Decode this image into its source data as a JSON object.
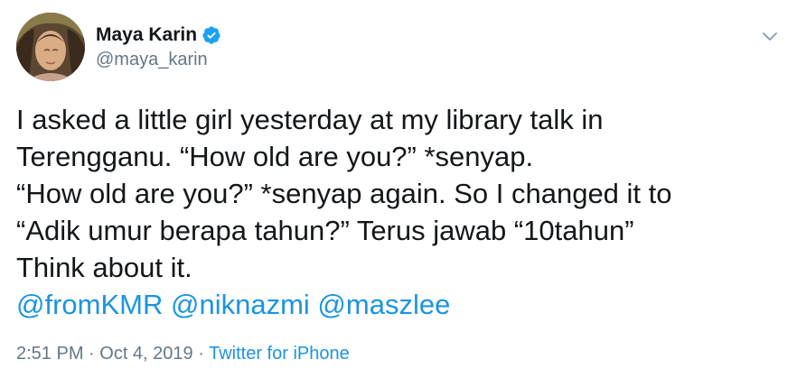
{
  "author": {
    "display_name": "Maya Karin",
    "handle": "@maya_karin",
    "verified": true
  },
  "tweet": {
    "lines": [
      "I asked a little girl yesterday at my library talk in",
      "Terengganu. “How old are you?” *senyap.",
      "“How old are you?” *senyap again. So I changed it to",
      "“Adik umur berapa tahun?” Terus jawab “10tahun”",
      "Think about it."
    ],
    "mentions": [
      "@fromKMR",
      "@niknazmi",
      "@maszlee"
    ]
  },
  "meta": {
    "time": "2:51 PM",
    "separator": " · ",
    "date": "Oct 4, 2019",
    "source": "Twitter for iPhone"
  },
  "icons": {
    "verified": "verified-badge-icon",
    "menu": "chevron-down-icon"
  },
  "colors": {
    "link": "#1b95e0",
    "secondary_text": "#657786",
    "primary_text": "#14171a",
    "verified": "#1da1f2"
  }
}
